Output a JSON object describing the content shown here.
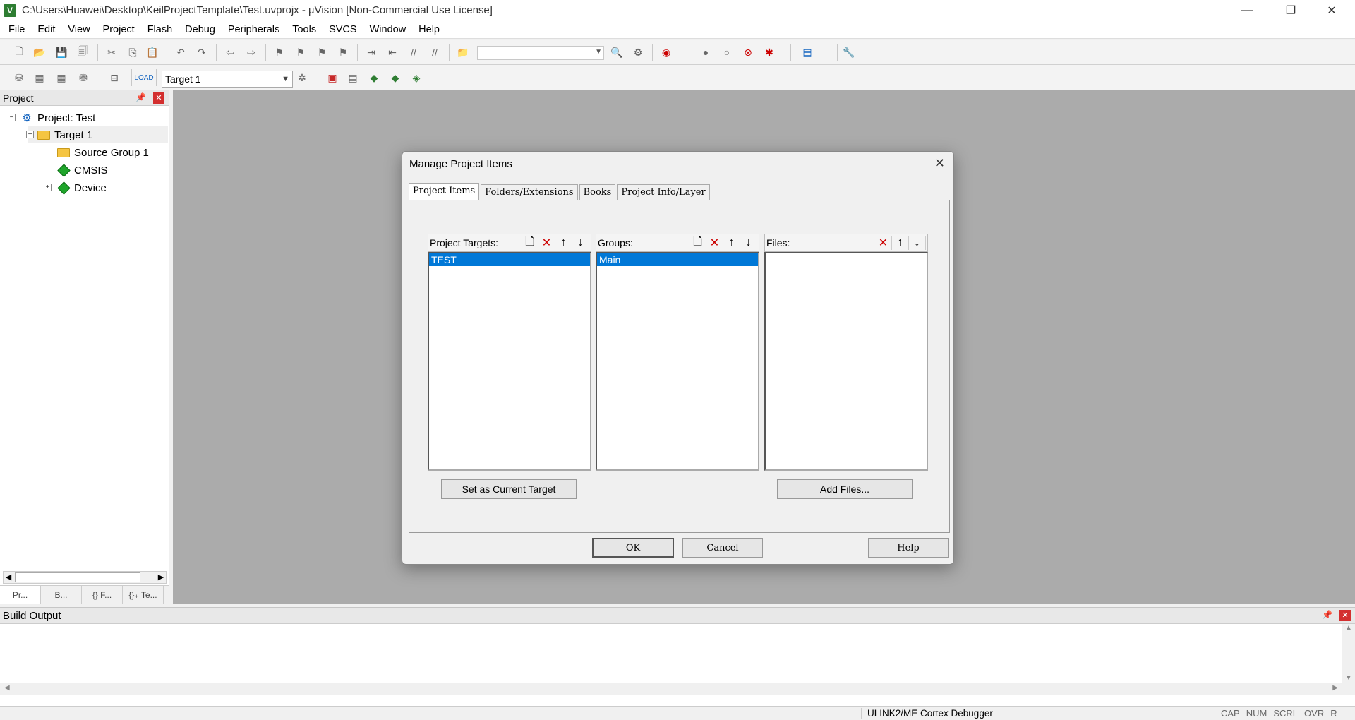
{
  "window": {
    "title": "C:\\Users\\Huawei\\Desktop\\KeilProjectTemplate\\Test.uvprojx - µVision  [Non-Commercial Use License]",
    "app_icon_letter": "V",
    "min_label": "—",
    "max_label": "❐",
    "close_label": "✕"
  },
  "menu": [
    "File",
    "Edit",
    "View",
    "Project",
    "Flash",
    "Debug",
    "Peripherals",
    "Tools",
    "SVCS",
    "Window",
    "Help"
  ],
  "toolbar2": {
    "target_combo": "Target 1"
  },
  "project_panel": {
    "title": "Project",
    "tree": {
      "project": "Project: Test",
      "target": "Target 1",
      "source_group": "Source Group 1",
      "cmsis": "CMSIS",
      "device": "Device"
    },
    "tabs": [
      "Pr...",
      "B...",
      "{} F...",
      "{}₊ Te..."
    ]
  },
  "dialog": {
    "title": "Manage Project Items",
    "close_label": "✕",
    "tabs": [
      "Project Items",
      "Folders/Extensions",
      "Books",
      "Project Info/Layer"
    ],
    "columns": {
      "targets": {
        "label": "Project Targets:",
        "items": [
          "TEST"
        ]
      },
      "groups": {
        "label": "Groups:",
        "items": [
          "Main"
        ]
      },
      "files": {
        "label": "Files:",
        "items": []
      }
    },
    "buttons": {
      "set_current": "Set as Current Target",
      "add_files": "Add Files...",
      "ok": "OK",
      "cancel": "Cancel",
      "help": "Help"
    }
  },
  "build_output": {
    "title": "Build Output"
  },
  "status": {
    "debugger": "ULINK2/ME Cortex Debugger",
    "flags": [
      "CAP",
      "NUM",
      "SCRL",
      "OVR",
      "R /W"
    ]
  }
}
